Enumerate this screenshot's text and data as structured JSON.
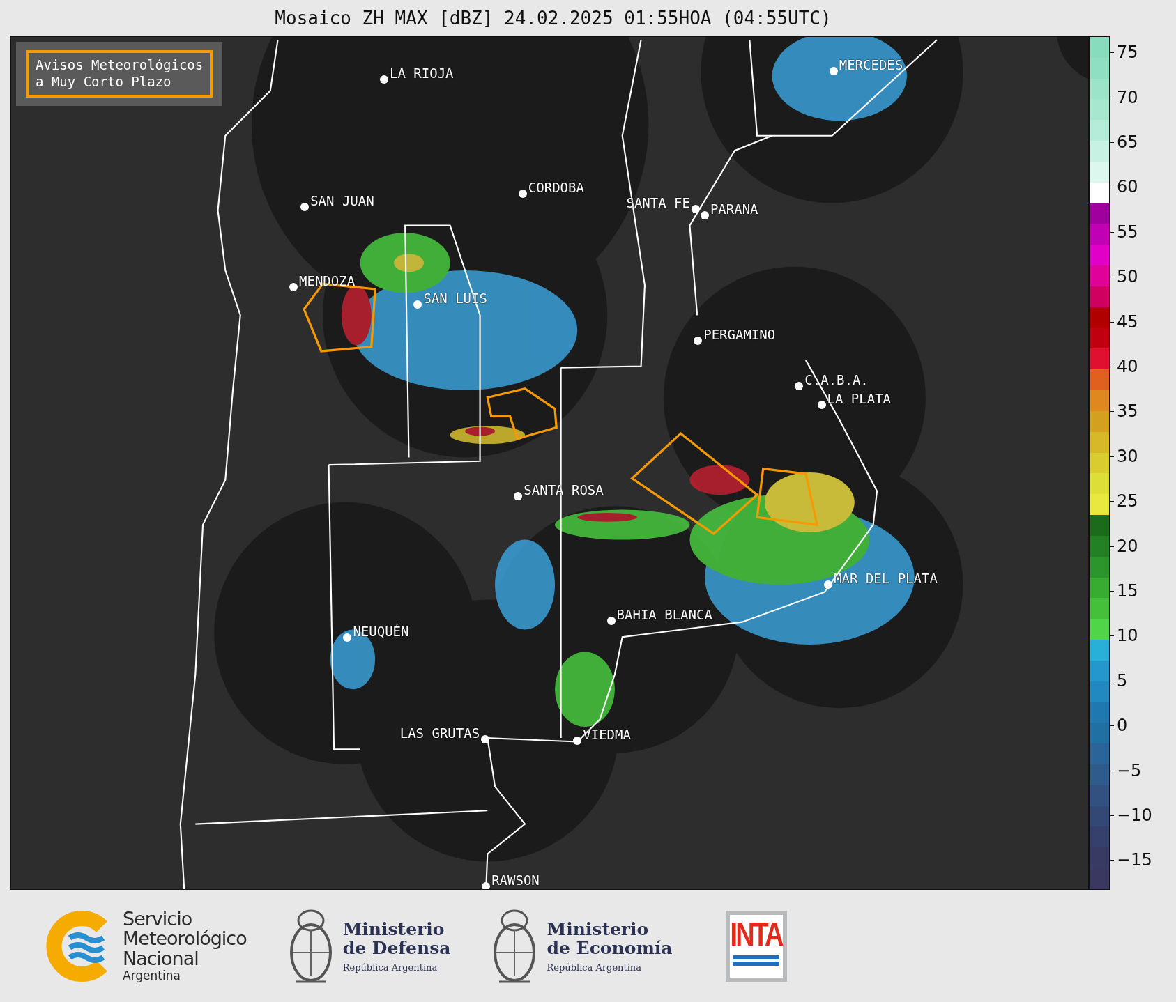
{
  "title": "Mosaico ZH MAX [dBZ] 24.02.2025 01:55HOA (04:55UTC)",
  "warning_legend": {
    "lines": [
      "Avisos Meteorológicos",
      "a Muy Corto Plazo"
    ]
  },
  "cities": [
    {
      "name": "LA RIOJA"
    },
    {
      "name": "MERCEDES"
    },
    {
      "name": "SAN JUAN"
    },
    {
      "name": "CORDOBA"
    },
    {
      "name": "SANTA FE"
    },
    {
      "name": "PARANA"
    },
    {
      "name": "MENDOZA"
    },
    {
      "name": "SAN LUIS"
    },
    {
      "name": "PERGAMINO"
    },
    {
      "name": "C.A.B.A."
    },
    {
      "name": "LA PLATA"
    },
    {
      "name": "SANTA ROSA"
    },
    {
      "name": "MAR DEL PLATA"
    },
    {
      "name": "BAHIA BLANCA"
    },
    {
      "name": "NEUQUÉN"
    },
    {
      "name": "LAS GRUTAS"
    },
    {
      "name": "VIEDMA"
    },
    {
      "name": "RAWSON"
    }
  ],
  "colorbar": {
    "ticks": [
      "75",
      "70",
      "65",
      "60",
      "55",
      "50",
      "45",
      "40",
      "35",
      "30",
      "25",
      "20",
      "15",
      "10",
      "5",
      "0",
      "−5",
      "−10",
      "−15"
    ]
  },
  "footer": {
    "logos": [
      {
        "kind": "smn",
        "lines": [
          "Servicio",
          "Meteorológico",
          "Nacional"
        ],
        "subtitle": "Argentina"
      },
      {
        "kind": "crest",
        "lines": [
          "Ministerio",
          "de Defensa"
        ],
        "subtitle": "República Argentina"
      },
      {
        "kind": "crest",
        "lines": [
          "Ministerio",
          "de Economía"
        ],
        "subtitle": "República Argentina"
      },
      {
        "kind": "inta",
        "lines": [
          "INTA"
        ]
      }
    ]
  }
}
